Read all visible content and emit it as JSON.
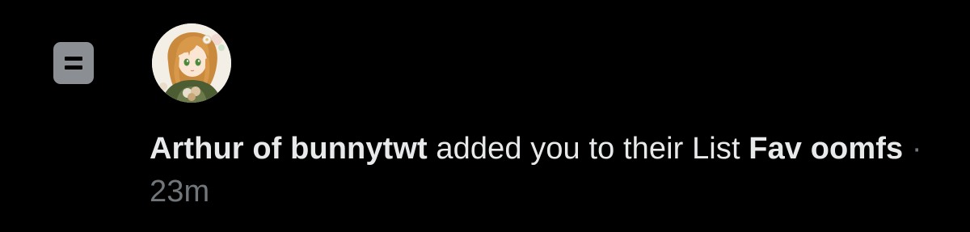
{
  "notification": {
    "actor_name": "Arthur of bunnytwt",
    "action_text": " added you to their List ",
    "list_name": "Fav oomfs",
    "separator": " · ",
    "timestamp": "23m"
  },
  "icons": {
    "type_icon": "list-icon",
    "avatar": "user-avatar"
  },
  "colors": {
    "background": "#000000",
    "primary_text": "#e7e9ea",
    "secondary_text": "#71767b",
    "list_icon": "#8b8f94"
  }
}
